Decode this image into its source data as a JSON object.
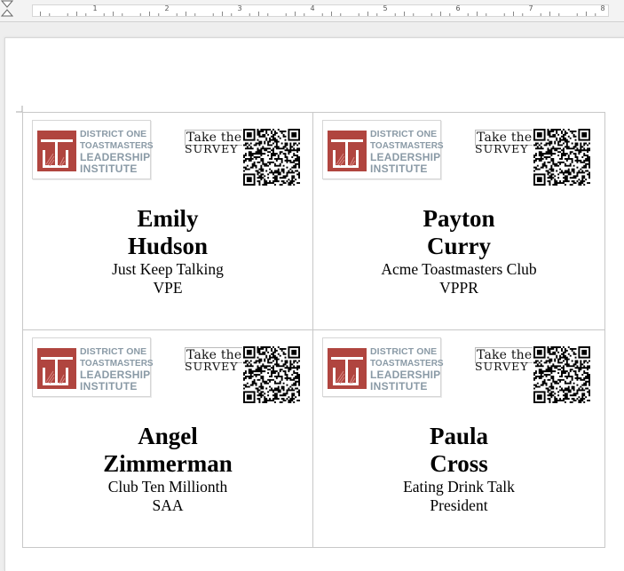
{
  "ruler": {
    "numbers": [
      "1",
      "2",
      "3",
      "4",
      "5",
      "6",
      "7",
      "8"
    ]
  },
  "logo": {
    "line1": "DISTRICT ONE",
    "line2": "TOASTMASTERS",
    "line3": "LEADERSHIP",
    "line4": "INSTITUTE",
    "brand_red": "#b0453f",
    "text_gray": "#8a9aa6"
  },
  "survey": {
    "top": "Take the",
    "bottom": "SURVEY"
  },
  "labels": [
    {
      "first": "Emily",
      "last": "Hudson",
      "club": "Just Keep Talking",
      "role": "VPE"
    },
    {
      "first": "Payton",
      "last": "Curry",
      "club": "Acme Toastmasters Club",
      "role": "VPPR"
    },
    {
      "first": "Angel",
      "last": "Zimmerman",
      "club": "Club Ten Millionth",
      "role": "SAA"
    },
    {
      "first": "Paula",
      "last": "Cross",
      "club": "Eating Drink Talk",
      "role": "President"
    }
  ]
}
